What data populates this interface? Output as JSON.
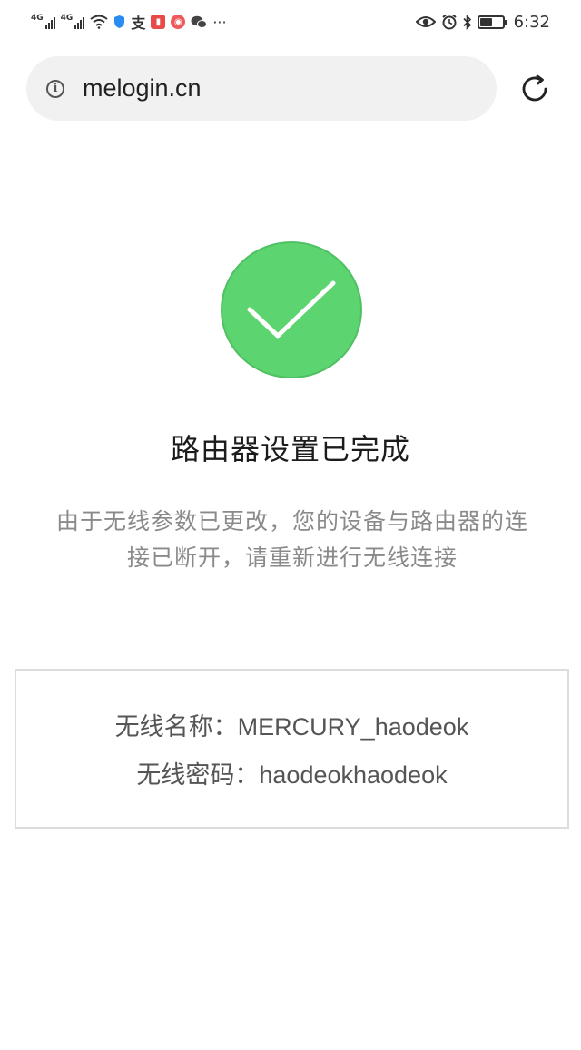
{
  "status_bar": {
    "network_1": "4G",
    "network_2": "4G",
    "time": "6:32",
    "battery_level": 0.55,
    "icons": [
      "signal-icon",
      "wifi-icon",
      "shield-icon",
      "alipay-icon",
      "book-icon",
      "podcast-icon",
      "wechat-icon",
      "more-icon",
      "eye-icon",
      "alarm-icon",
      "bluetooth-icon",
      "battery-icon"
    ]
  },
  "browser": {
    "url": "melogin.cn"
  },
  "main": {
    "title": "路由器设置已完成",
    "description_line1": "由于无线参数已更改，您的设备与路由器的连",
    "description_line2": "接已断开，请重新进行无线连接",
    "wifi_name_label": "无线名称：",
    "wifi_name_value": "MERCURY_haodeok",
    "wifi_password_label": "无线密码：",
    "wifi_password_value": "haodeokhaodeok"
  },
  "colors": {
    "success_green": "#5cd470",
    "success_border": "#4fc063",
    "url_bar_bg": "#f1f1f1",
    "desc_gray": "#8a8a8a",
    "box_border": "#dcdcdc"
  }
}
